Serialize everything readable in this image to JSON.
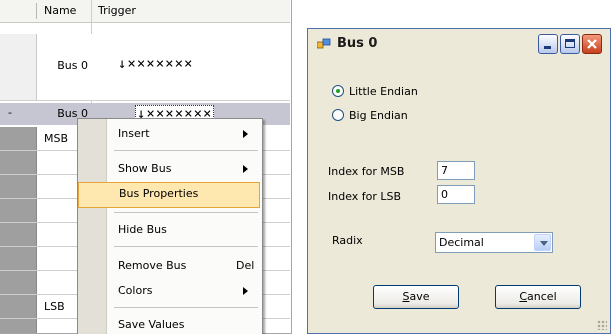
{
  "grid": {
    "col_name": "Name",
    "col_trigger": "Trigger",
    "bus_row": {
      "name": "Bus 0",
      "trigger": "↓×××××××"
    },
    "selected_row": {
      "marker": "-",
      "name": "Bus 0",
      "trigger": "↓×××××××"
    },
    "sub_rows": [
      "MSB",
      "",
      "",
      "",
      "",
      "",
      "",
      "LSB"
    ]
  },
  "context_menu": {
    "items": [
      {
        "label": "Insert",
        "submenu": true
      },
      {
        "label": "Show Bus",
        "submenu": true
      },
      {
        "label": "Bus Properties",
        "highlighted": true
      },
      {
        "label": "Hide Bus"
      },
      {
        "label": "Remove Bus",
        "shortcut": "Del"
      },
      {
        "label": "Colors",
        "submenu": true
      },
      {
        "label": "Save Values"
      }
    ]
  },
  "dialog": {
    "title": "Bus 0",
    "endian": {
      "options": [
        "Little Endian",
        "Big Endian"
      ],
      "selected": "Little Endian"
    },
    "msb_label": "Index for MSB",
    "msb_value": "7",
    "lsb_label": "Index for LSB",
    "lsb_value": "0",
    "radix_label": "Radix",
    "radix_value": "Decimal",
    "save_accel": "S",
    "save_rest": "ave",
    "cancel_accel": "C",
    "cancel_rest": "ancel"
  },
  "colors": {
    "menu_highlight": "#ffe8b0",
    "selected_row": "#c6c6d2",
    "dialog_bg": "#ece9d8",
    "close_button": "#c7401d"
  }
}
